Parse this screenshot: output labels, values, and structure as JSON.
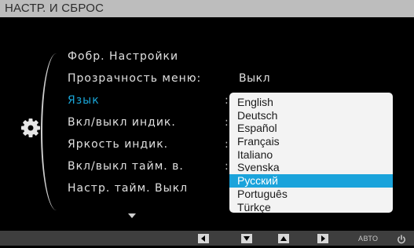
{
  "title": "НАСТР. И СБРОС",
  "menu": {
    "items": [
      {
        "label": "Фобр. Настройки",
        "separator": ""
      },
      {
        "label": "Прозрачность меню",
        "separator": ":"
      },
      {
        "label": "Язык",
        "separator": ":"
      },
      {
        "label": "Вкл/выкл индик.",
        "separator": ":"
      },
      {
        "label": "Яркость индик.",
        "separator": ":"
      },
      {
        "label": "Вкл/выкл тайм. в.",
        "separator": ":"
      },
      {
        "label": "Настр. тайм. Выкл",
        "separator": ""
      }
    ],
    "transparency_value": "Выкл"
  },
  "language_dropdown": {
    "options": [
      "English",
      "Deutsch",
      "Español",
      "Français",
      "Italiano",
      "Svenska",
      "Русский",
      "Português",
      "Türkçe"
    ],
    "selected": "Русский"
  },
  "bottom_bar": {
    "auto_label": "АВТО",
    "buttons": [
      "left-button",
      "down-button",
      "up-button",
      "enter-button",
      "auto-button",
      "power-button"
    ]
  },
  "colors": {
    "accent": "#19a6d8",
    "titlebar": "#bdbdbd",
    "background": "#000000",
    "dropdown_bg": "#f3f3f3"
  }
}
